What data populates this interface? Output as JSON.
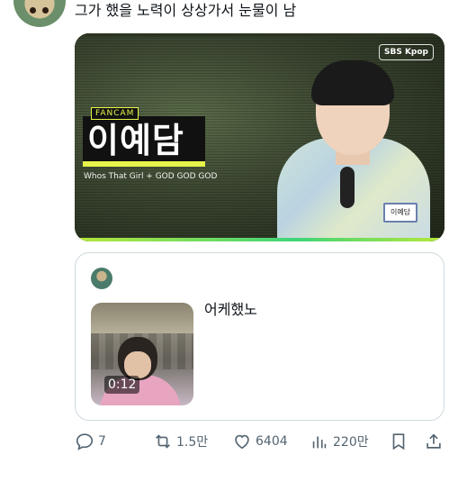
{
  "tweet": {
    "text": "그가 했을 노력이 상상가서 눈물이 남"
  },
  "video": {
    "fancam_label": "FANCAM",
    "name": "이예담",
    "song": "Whos That Girl + GOD GOD GOD",
    "logo": "SBS Kpop",
    "name_tag": "이예담"
  },
  "quote": {
    "text": "어케했노",
    "duration": "0:12"
  },
  "actions": {
    "replies": "7",
    "retweets": "1.5만",
    "likes": "6404",
    "views": "220만"
  }
}
